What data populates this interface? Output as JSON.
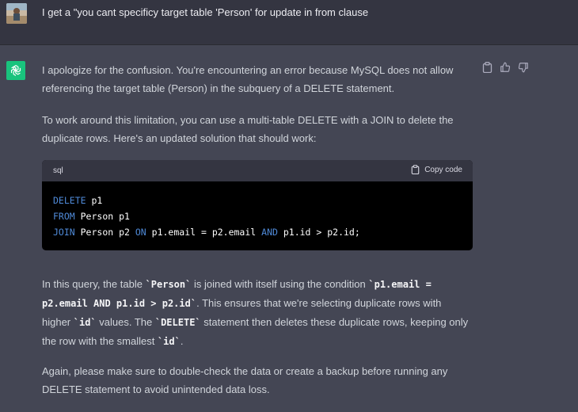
{
  "user_message": {
    "text": "I get a \"you cant specificy target table 'Person' for update in from clause"
  },
  "assistant_message": {
    "para1": "I apologize for the confusion. You're encountering an error because MySQL does not allow referencing the target table (Person) in the subquery of a DELETE statement.",
    "para2": "To work around this limitation, you can use a multi-table DELETE with a JOIN to delete the duplicate rows. Here's an updated solution that should work:",
    "code": {
      "language": "sql",
      "copy_label": "Copy code",
      "line1_kw": "DELETE",
      "line1_rest": " p1",
      "line2_kw": "FROM",
      "line2_rest": " Person p1",
      "line3_kw": "JOIN",
      "line3_mid1": " Person p2 ",
      "line3_kw2": "ON",
      "line3_mid2": " p1.email = p2.email ",
      "line3_kw3": "AND",
      "line3_rest": " p1.id > p2.id;"
    },
    "para3": {
      "t1": "In this query, the table ",
      "c1": "`Person`",
      "t2": " is joined with itself using the condition ",
      "c2": "`p1.email = p2.email AND p1.id > p2.id`",
      "t3": ". This ensures that we're selecting duplicate rows with higher ",
      "c3": "`id`",
      "t4": " values. The ",
      "c4": "`DELETE`",
      "t5": " statement then deletes these duplicate rows, keeping only the row with the smallest ",
      "c5": "`id`",
      "t6": "."
    },
    "para4": "Again, please make sure to double-check the data or create a backup before running any DELETE statement to avoid unintended data loss."
  },
  "icons": {
    "user_avatar": "user-avatar-photo",
    "assistant_avatar": "openai-logo-icon",
    "copy": "clipboard-icon",
    "thumbs_up": "thumbs-up-icon",
    "thumbs_down": "thumbs-down-icon"
  },
  "colors": {
    "page_bg": "#444654",
    "user_row_bg": "#343541",
    "assistant_avatar_bg": "#19c37d",
    "code_keyword": "#4f8ad8"
  }
}
